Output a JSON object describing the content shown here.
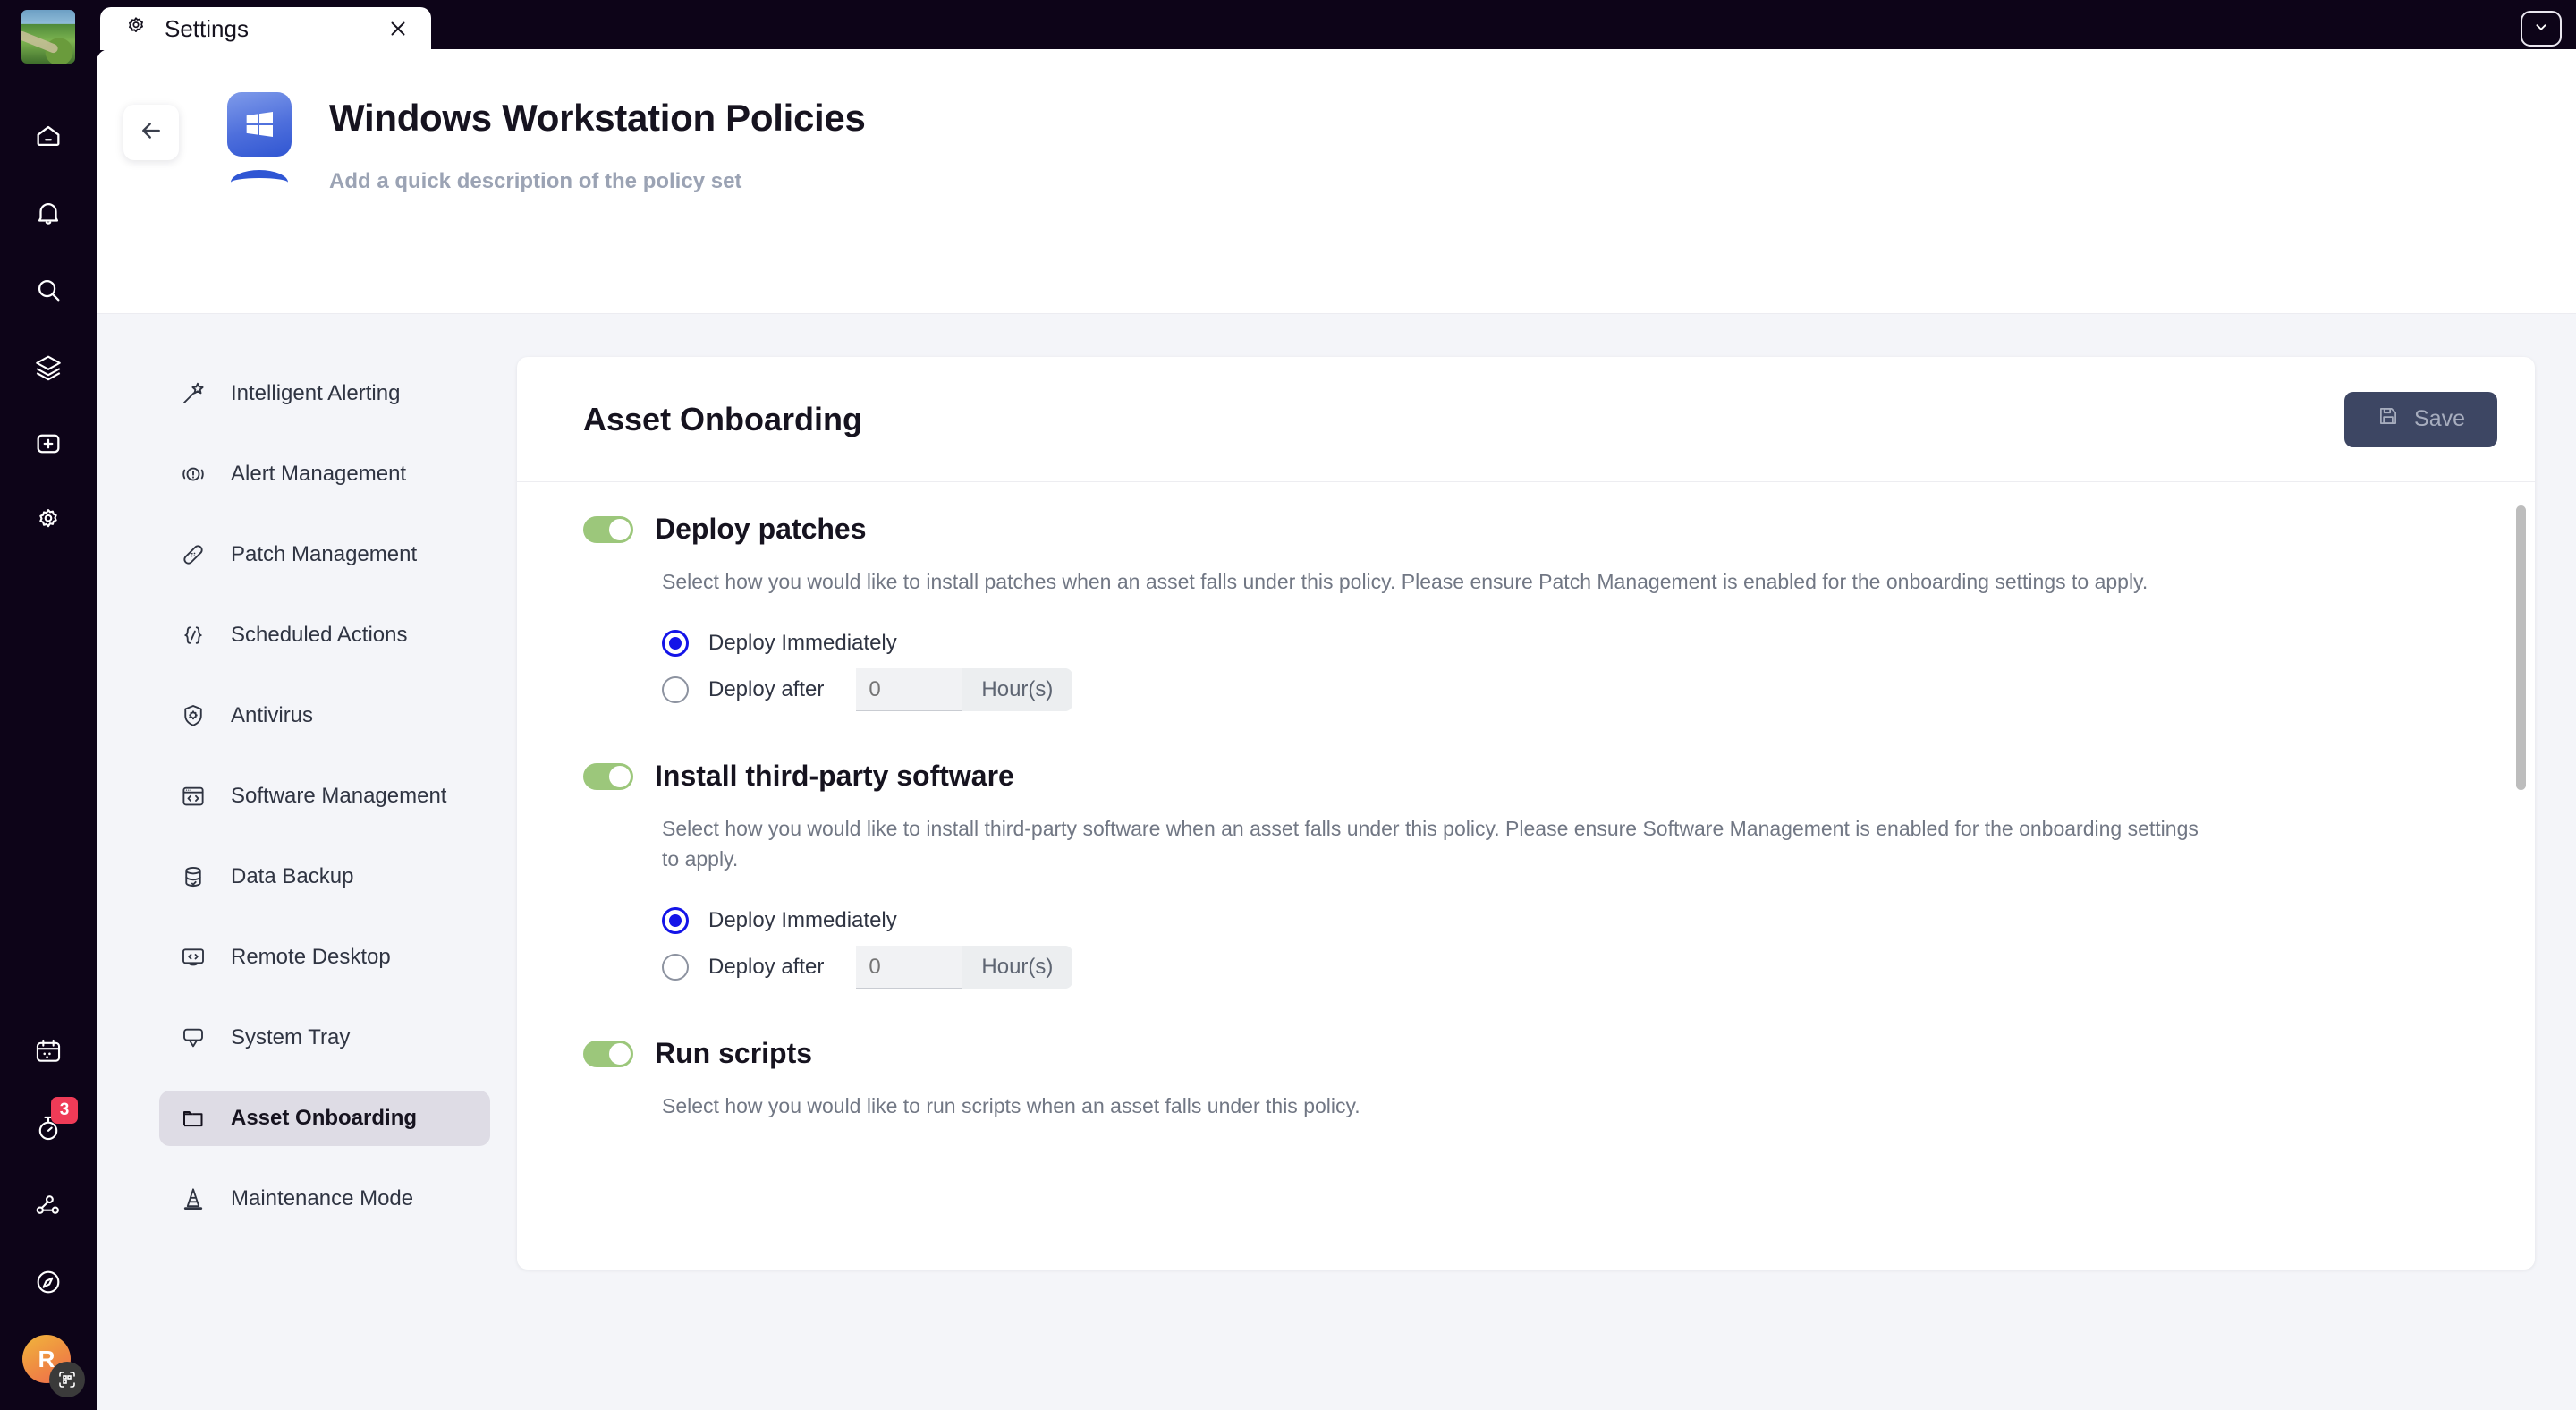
{
  "window": {
    "tab": {
      "title": "Settings",
      "icon": "gear-icon",
      "close_icon": "close-icon"
    },
    "collapse_icon": "chevron-down-icon"
  },
  "rail": {
    "thumbnail": "wallpaper-thumbnail",
    "top_items": [
      {
        "name": "home-icon"
      },
      {
        "name": "bell-icon"
      },
      {
        "name": "search-icon"
      },
      {
        "name": "layers-icon"
      },
      {
        "name": "plus-square-icon"
      },
      {
        "name": "gear-icon"
      }
    ],
    "bottom_items": [
      {
        "name": "calendar-icon",
        "badge": ""
      },
      {
        "name": "stopwatch-icon",
        "badge": "3"
      },
      {
        "name": "network-nodes-icon",
        "badge": ""
      },
      {
        "name": "compass-icon",
        "badge": ""
      }
    ],
    "avatar": {
      "initial": "R",
      "badge_icon": "qr-code-icon"
    }
  },
  "header": {
    "back_icon": "arrow-left-icon",
    "policy_icon": "windows-logo-icon",
    "title": "Windows Workstation Policies",
    "description": "Add a quick description of the policy set"
  },
  "settings_nav": {
    "items": [
      {
        "label": "Intelligent Alerting",
        "icon": "magic-wand-icon",
        "active": false
      },
      {
        "label": "Alert Management",
        "icon": "alert-circle-icon",
        "active": false
      },
      {
        "label": "Patch Management",
        "icon": "bandage-icon",
        "active": false
      },
      {
        "label": "Scheduled Actions",
        "icon": "code-braces-icon",
        "active": false
      },
      {
        "label": "Antivirus",
        "icon": "shield-virus-icon",
        "active": false
      },
      {
        "label": "Software Management",
        "icon": "browser-code-icon",
        "active": false
      },
      {
        "label": "Data Backup",
        "icon": "database-check-icon",
        "active": false
      },
      {
        "label": "Remote Desktop",
        "icon": "monitor-code-icon",
        "active": false
      },
      {
        "label": "System Tray",
        "icon": "tray-icon",
        "active": false
      },
      {
        "label": "Asset Onboarding",
        "icon": "folder-icon",
        "active": true
      },
      {
        "label": "Maintenance Mode",
        "icon": "traffic-cone-icon",
        "active": false
      }
    ]
  },
  "card": {
    "title": "Asset Onboarding",
    "save_label": "Save",
    "save_icon": "floppy-disk-icon",
    "save_enabled": false,
    "sections": [
      {
        "id": "deploy-patches",
        "title": "Deploy patches",
        "toggle_on": true,
        "description": "Select how you would like to install patches when an asset falls under this policy. Please ensure Patch Management is enabled for the onboarding settings to apply.",
        "options": [
          {
            "label": "Deploy Immediately",
            "checked": true
          },
          {
            "label": "Deploy after",
            "checked": false,
            "value": "",
            "placeholder": "0",
            "unit": "Hour(s)"
          }
        ]
      },
      {
        "id": "install-third-party-software",
        "title": "Install third-party software",
        "toggle_on": true,
        "description": "Select how you would like to install third-party software when an asset falls under this policy. Please ensure Software Management is enabled for the onboarding settings to apply.",
        "options": [
          {
            "label": "Deploy Immediately",
            "checked": true
          },
          {
            "label": "Deploy after",
            "checked": false,
            "value": "",
            "placeholder": "0",
            "unit": "Hour(s)"
          }
        ]
      },
      {
        "id": "run-scripts",
        "title": "Run scripts",
        "toggle_on": true,
        "description": "Select how you would like to run scripts when an asset falls under this policy.",
        "options": []
      }
    ]
  },
  "colors": {
    "rail_bg": "#0d0418",
    "page_bg": "#f4f5f9",
    "accent_blue": "#3056d2",
    "toggle_green": "#9cc77b",
    "radio_blue": "#1414e8",
    "badge_red": "#ef3b57",
    "save_bg": "#3d4663"
  }
}
